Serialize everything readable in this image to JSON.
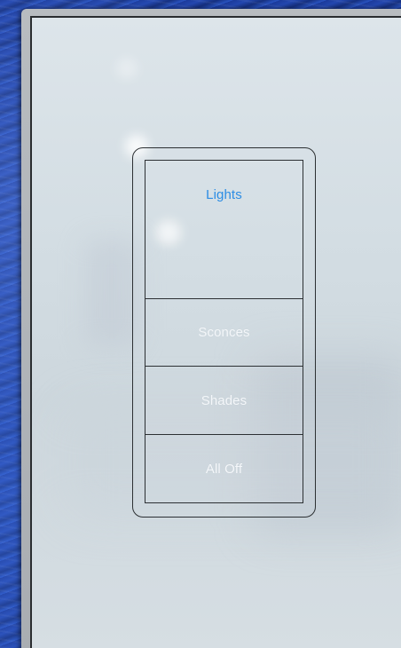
{
  "keypad": {
    "buttons": [
      {
        "label": "Lights",
        "state": "active"
      },
      {
        "label": "Sconces",
        "state": "inactive"
      },
      {
        "label": "Shades",
        "state": "inactive"
      },
      {
        "label": "All Off",
        "state": "inactive"
      }
    ]
  },
  "colors": {
    "active_label": "#2e8fe6",
    "inactive_label": "#f4f7fa",
    "outline": "#2c3033",
    "panel_face": "#d3dde3",
    "backdrop": "#2448b0"
  }
}
